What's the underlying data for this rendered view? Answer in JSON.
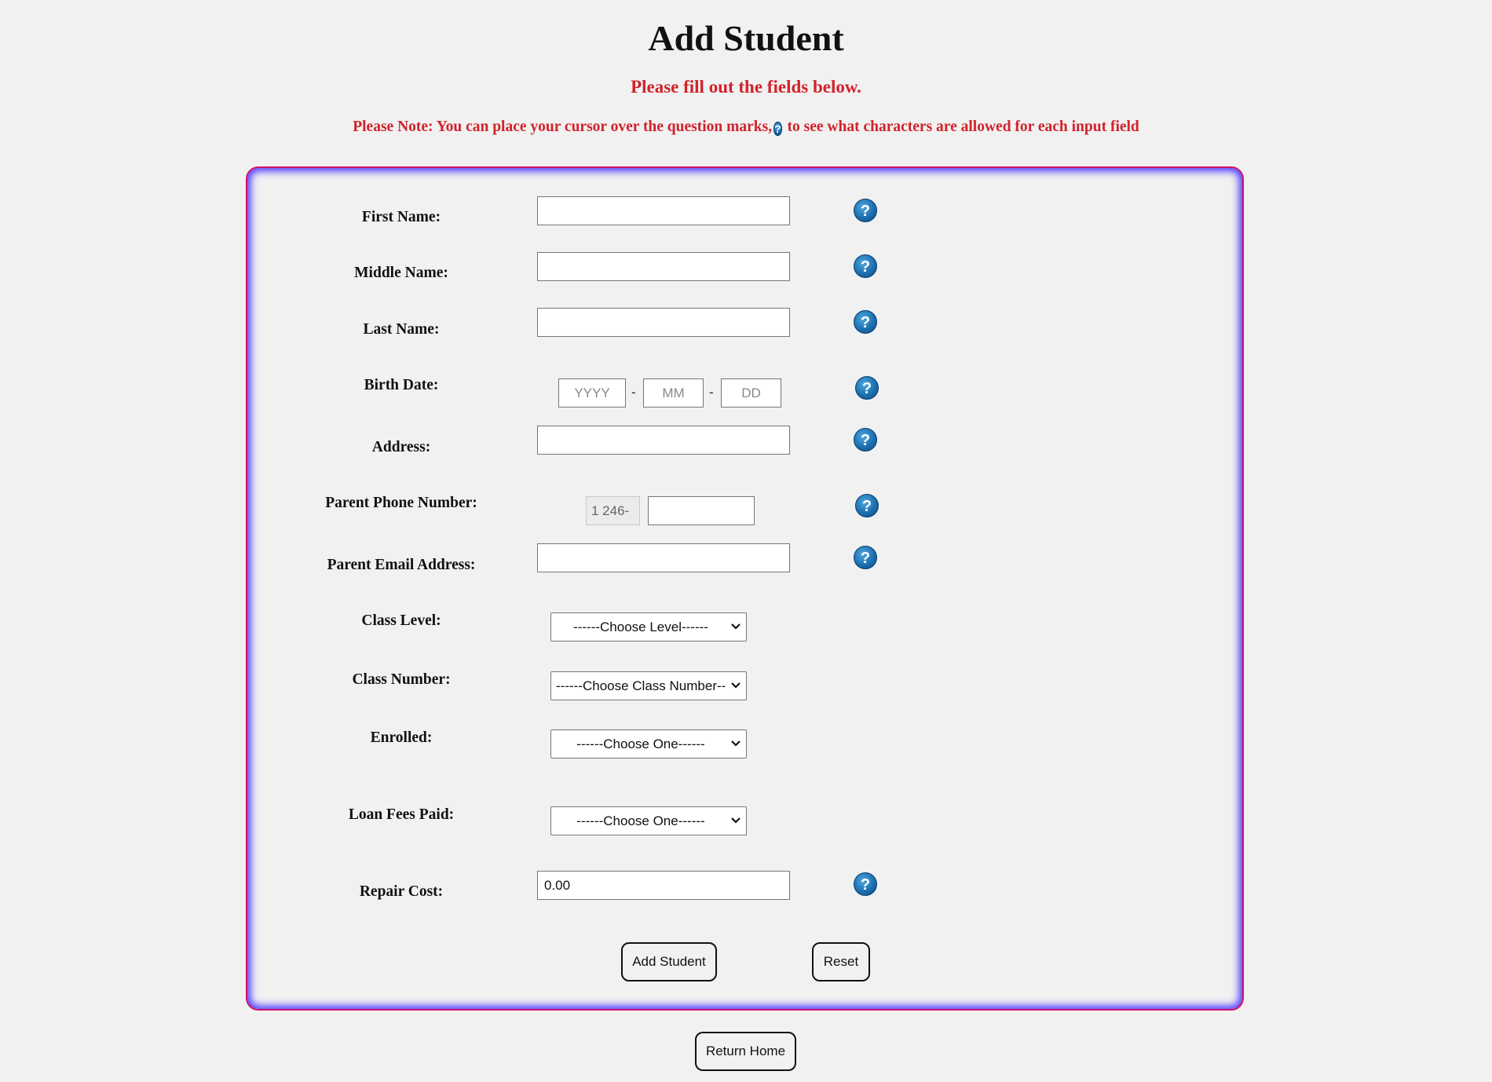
{
  "page": {
    "title": "Add Student",
    "subtitle": "Please fill out the fields below.",
    "note_before": "Please Note: You can place your cursor over the question marks,",
    "note_after": "to see what characters are allowed for each input field",
    "help_glyph": "?"
  },
  "form": {
    "first_name": {
      "label": "First Name:",
      "value": ""
    },
    "middle_name": {
      "label": "Middle Name:",
      "value": ""
    },
    "last_name": {
      "label": "Last Name:",
      "value": ""
    },
    "birth_date": {
      "label": "Birth Date:",
      "year_placeholder": "YYYY",
      "month_placeholder": "MM",
      "day_placeholder": "DD",
      "separator": "-"
    },
    "address": {
      "label": "Address:",
      "value": ""
    },
    "parent_phone": {
      "label": "Parent Phone Number:",
      "prefix": "1 246-",
      "value": ""
    },
    "parent_email": {
      "label": "Parent Email Address:",
      "value": ""
    },
    "class_level": {
      "label": "Class Level:",
      "selected": "------Choose Level------"
    },
    "class_number": {
      "label": "Class Number:",
      "selected": "------Choose Class Number------"
    },
    "enrolled": {
      "label": "Enrolled:",
      "selected": "------Choose One------"
    },
    "loan_fees_paid": {
      "label": "Loan Fees Paid:",
      "selected": "------Choose One------"
    },
    "repair_cost": {
      "label": "Repair Cost:",
      "value": "0.00"
    },
    "add_button": "Add Student",
    "reset_button": "Reset"
  },
  "return_home": "Return Home",
  "icons": {
    "help": "help-question-icon",
    "select_arrow": "chevron-down-icon"
  },
  "colors": {
    "notice_red": "#d1222b",
    "border_magenta": "#d0106a",
    "glow_blue": "#4a35ff",
    "help_blue": "#1c6fae"
  }
}
